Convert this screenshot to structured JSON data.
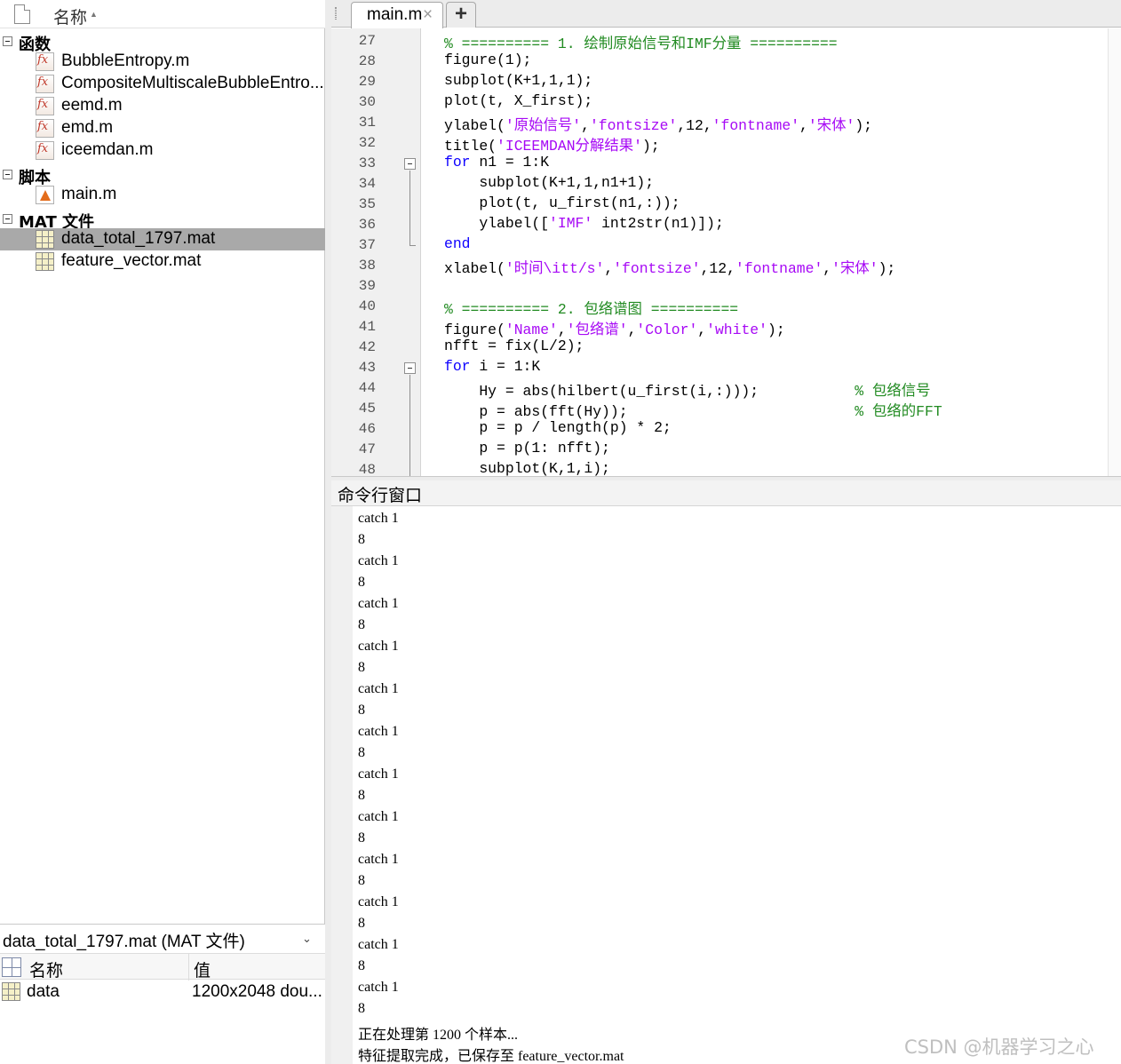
{
  "file_browser": {
    "column_name": "名称",
    "groups": [
      {
        "label": "函数",
        "files": [
          "BubbleEntropy.m",
          "CompositeMultiscaleBubbleEntro...",
          "eemd.m",
          "emd.m",
          "iceemdan.m"
        ]
      },
      {
        "label": "脚本",
        "files": [
          "main.m"
        ]
      },
      {
        "label": "MAT 文件",
        "files": [
          "data_total_1797.mat",
          "feature_vector.mat"
        ]
      }
    ],
    "selected_file": "data_total_1797.mat"
  },
  "details": {
    "title": "data_total_1797.mat  (MAT 文件)",
    "col_name": "名称",
    "col_value": "值",
    "variables": [
      {
        "name": "data",
        "value": "1200x2048 dou..."
      }
    ]
  },
  "editor": {
    "tab_label": "main.m",
    "close_glyph": "×",
    "add_glyph": "+",
    "line_numbers": [
      "27",
      "28",
      "29",
      "30",
      "31",
      "32",
      "33",
      "34",
      "35",
      "36",
      "37",
      "38",
      "39",
      "40",
      "41",
      "42",
      "43",
      "44",
      "45",
      "46",
      "47",
      "48"
    ]
  },
  "command_window": {
    "title": "命令行窗口",
    "output": [
      "catch 1",
      "8",
      "catch 1",
      "8",
      "catch 1",
      "8",
      "catch 1",
      "8",
      "catch 1",
      "8",
      "catch 1",
      "8",
      "catch 1",
      "8",
      "catch 1",
      "8",
      "catch 1",
      "8",
      "catch 1",
      "8",
      "catch 1",
      "8",
      "catch 1",
      "8",
      "正在处理第 1200 个样本...",
      "特征提取完成，已保存至 feature_vector.mat"
    ]
  },
  "watermark": "CSDN @机器学习之心",
  "colors": {
    "keyword": "#0e00ff",
    "string": "#a709f5",
    "comment": "#228b22",
    "selection": "#a9a9a9"
  }
}
